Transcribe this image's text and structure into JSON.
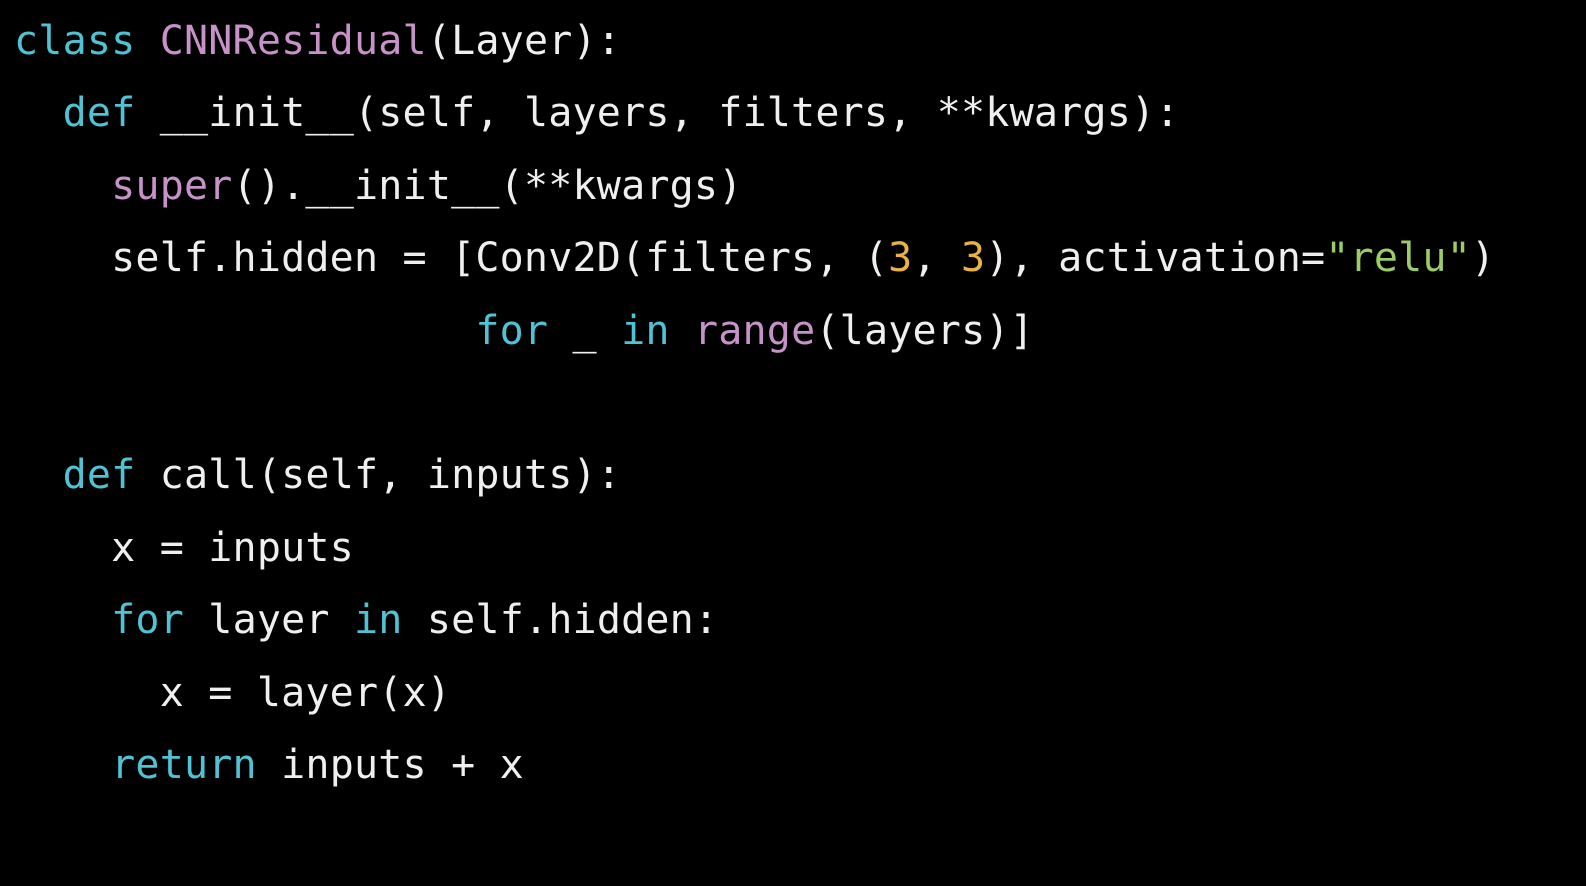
{
  "colors": {
    "background": "#000000",
    "keyword": "#4fc3d4",
    "builtin": "#c792c8",
    "number": "#e8b341",
    "string": "#9ccc65",
    "plain": "#efefef"
  },
  "lines": [
    [
      {
        "text": "class ",
        "kind": "keyword"
      },
      {
        "text": "CNNResidual",
        "kind": "builtin"
      },
      {
        "text": "(Layer):",
        "kind": "plain"
      }
    ],
    [
      {
        "text": "  ",
        "kind": "plain"
      },
      {
        "text": "def",
        "kind": "keyword"
      },
      {
        "text": " __init__(self, layers, filters, **kwargs):",
        "kind": "plain"
      }
    ],
    [
      {
        "text": "    ",
        "kind": "plain"
      },
      {
        "text": "super",
        "kind": "builtin"
      },
      {
        "text": "().__init__(**kwargs)",
        "kind": "plain"
      }
    ],
    [
      {
        "text": "    self.hidden = [Conv2D(filters, (",
        "kind": "plain"
      },
      {
        "text": "3",
        "kind": "number"
      },
      {
        "text": ", ",
        "kind": "plain"
      },
      {
        "text": "3",
        "kind": "number"
      },
      {
        "text": "), activation=",
        "kind": "plain"
      },
      {
        "text": "\"relu\"",
        "kind": "string"
      },
      {
        "text": ")",
        "kind": "plain"
      }
    ],
    [
      {
        "text": "                   ",
        "kind": "plain"
      },
      {
        "text": "for",
        "kind": "keyword"
      },
      {
        "text": " _ ",
        "kind": "plain"
      },
      {
        "text": "in",
        "kind": "keyword"
      },
      {
        "text": " ",
        "kind": "plain"
      },
      {
        "text": "range",
        "kind": "builtin"
      },
      {
        "text": "(layers)]",
        "kind": "plain"
      }
    ],
    [],
    [
      {
        "text": "  ",
        "kind": "plain"
      },
      {
        "text": "def",
        "kind": "keyword"
      },
      {
        "text": " call(self, inputs):",
        "kind": "plain"
      }
    ],
    [
      {
        "text": "    x = inputs",
        "kind": "plain"
      }
    ],
    [
      {
        "text": "    ",
        "kind": "plain"
      },
      {
        "text": "for",
        "kind": "keyword"
      },
      {
        "text": " layer ",
        "kind": "plain"
      },
      {
        "text": "in",
        "kind": "keyword"
      },
      {
        "text": " self.hidden:",
        "kind": "plain"
      }
    ],
    [
      {
        "text": "      x = layer(x)",
        "kind": "plain"
      }
    ],
    [
      {
        "text": "    ",
        "kind": "plain"
      },
      {
        "text": "return",
        "kind": "keyword"
      },
      {
        "text": " inputs + x",
        "kind": "plain"
      }
    ]
  ]
}
